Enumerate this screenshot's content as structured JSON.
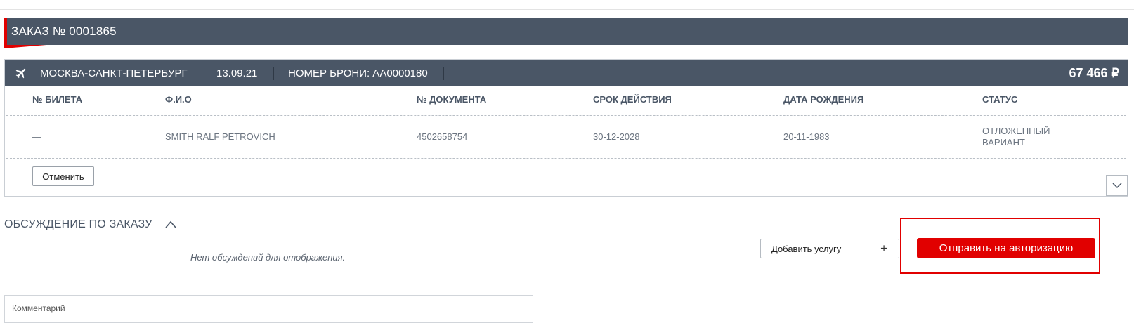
{
  "order": {
    "title": "ЗАКАЗ № 0001865",
    "accent_color": "#e10000",
    "header_color": "#4a5666"
  },
  "flight": {
    "route": "МОСКВА-САНКТ-ПЕТЕРБУРГ",
    "date": "13.09.21",
    "booking": "НОМЕР БРОНИ: AA0000180",
    "price": "67 466 ₽",
    "icon": "airplane-icon"
  },
  "table": {
    "headers": [
      "№ БИЛЕТА",
      "Ф.И.О",
      "№ ДОКУМЕНТА",
      "СРОК ДЕЙСТВИЯ",
      "ДАТА РОЖДЕНИЯ",
      "СТАТУС"
    ],
    "rows": [
      {
        "ticket": "—",
        "name": "SMITH RALF PETROVICH",
        "document": "4502658754",
        "expiry": "30-12-2028",
        "birth": "20-11-1983",
        "status_line1": "ОТЛОЖЕННЫЙ",
        "status_line2": "ВАРИАНТ"
      }
    ]
  },
  "actions": {
    "cancel": "Отменить",
    "add_service": "Добавить услугу",
    "add_service_icon": "plus-icon",
    "send": "Отправить на авторизацию"
  },
  "discussion": {
    "title": "ОБСУЖДЕНИЕ ПО ЗАКАЗУ",
    "empty": "Нет обсуждений для отображения.",
    "comment_placeholder": "Комментарий"
  }
}
